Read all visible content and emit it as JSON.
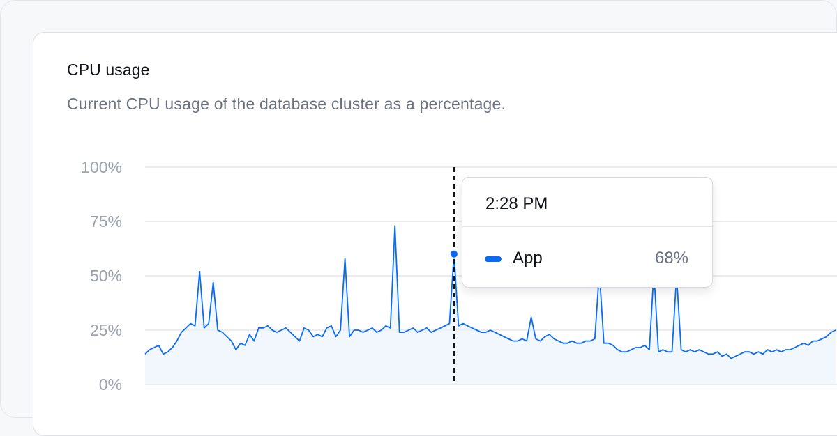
{
  "card": {
    "title": "CPU usage",
    "subtitle": "Current CPU usage of the database cluster as a percentage."
  },
  "tooltip": {
    "time": "2:28 PM",
    "series_name": "App",
    "value": "68%"
  },
  "colors": {
    "line": "#0a6cf5",
    "area": "#eaf2fe",
    "grid": "#e3e5e9",
    "cursor": "#111418",
    "tick_text": "#9ca3af"
  },
  "chart_data": {
    "type": "area",
    "y_ticks": [
      "100%",
      "75%",
      "50%",
      "25%",
      "0%"
    ],
    "y_tick_values": [
      100,
      75,
      50,
      25,
      0
    ],
    "ylim": [
      0,
      100
    ],
    "grid": true,
    "highlight_index": 68,
    "series": [
      {
        "name": "App",
        "values": [
          14,
          16,
          17,
          18,
          14,
          15,
          17,
          20,
          24,
          26,
          28,
          27,
          52,
          26,
          28,
          47,
          25,
          24,
          22,
          20,
          16,
          19,
          18,
          23,
          20,
          26,
          26,
          27,
          25,
          24,
          25,
          26,
          24,
          22,
          20,
          26,
          25,
          22,
          23,
          22,
          26,
          27,
          22,
          25,
          58,
          22,
          25,
          25,
          24,
          25,
          26,
          24,
          25,
          27,
          26,
          73,
          24,
          24,
          25,
          26,
          24,
          25,
          26,
          24,
          25,
          26,
          27,
          28,
          60,
          27,
          28,
          27,
          26,
          25,
          24,
          24,
          25,
          24,
          23,
          22,
          21,
          20,
          20,
          21,
          20,
          31,
          21,
          20,
          22,
          23,
          21,
          20,
          19,
          19,
          20,
          19,
          19,
          20,
          20,
          21,
          52,
          19,
          19,
          18,
          16,
          15,
          15,
          16,
          17,
          17,
          18,
          16,
          52,
          15,
          16,
          15,
          15,
          50,
          16,
          15,
          16,
          15,
          16,
          15,
          14,
          14,
          15,
          13,
          14,
          12,
          13,
          14,
          15,
          15,
          14,
          15,
          14,
          16,
          15,
          16,
          15,
          16,
          16,
          17,
          18,
          19,
          18,
          20,
          20,
          21,
          22,
          24,
          25
        ]
      }
    ]
  }
}
